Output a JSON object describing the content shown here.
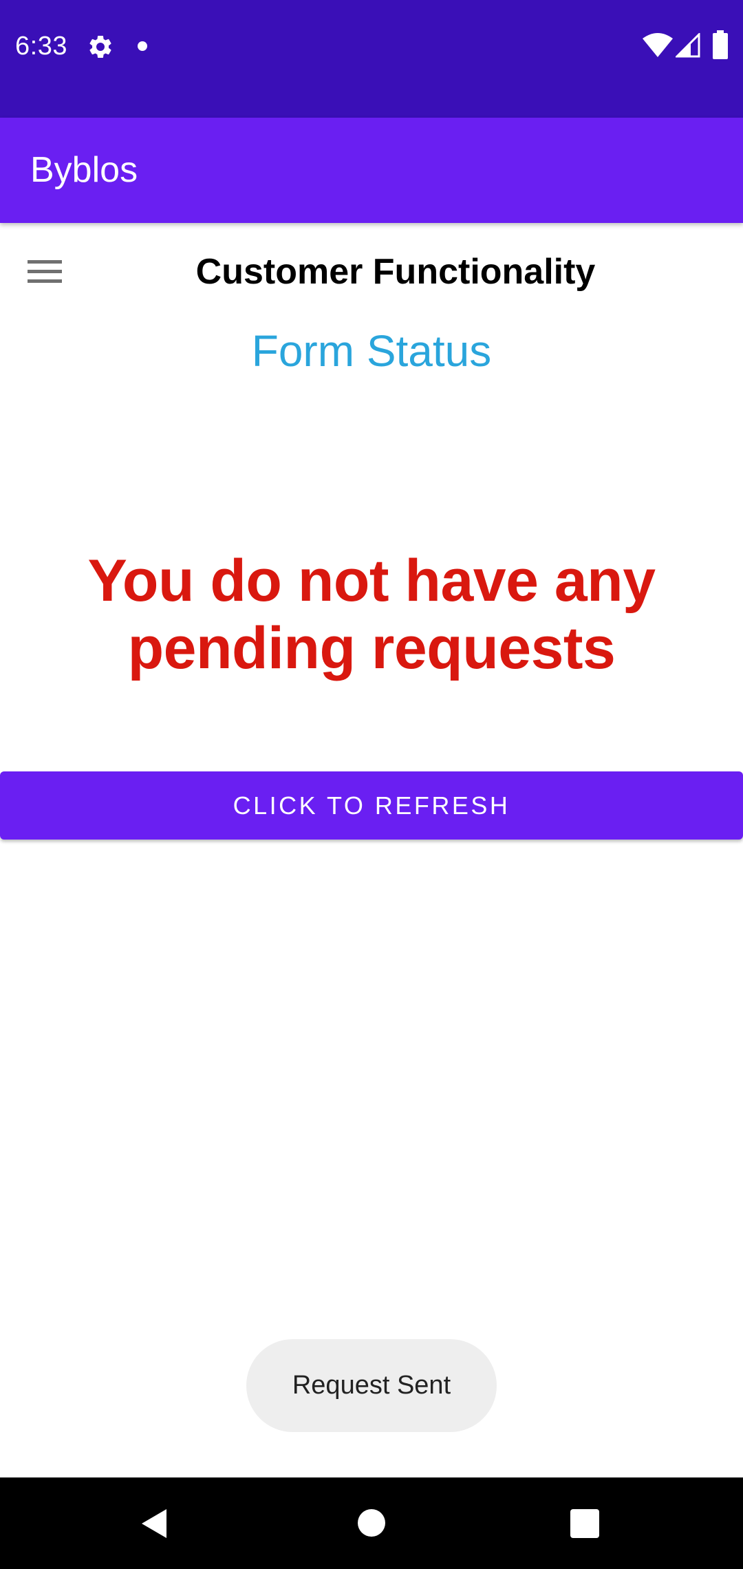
{
  "status_bar": {
    "time": "6:33",
    "icons": [
      "gear-icon",
      "notification-dot-icon",
      "wifi-icon",
      "signal-icon",
      "battery-icon"
    ],
    "background_color": "#3a0fb7"
  },
  "app_bar": {
    "title": "Byblos",
    "background_color": "#6a1ff2"
  },
  "header": {
    "menu_icon": "hamburger-menu-icon",
    "title": "Customer Functionality"
  },
  "main": {
    "subtitle": "Form Status",
    "subtitle_color": "#2aa5dc",
    "message": "You do not have any pending requests",
    "message_color": "#d9180f",
    "refresh_button_label": "CLICK TO REFRESH",
    "button_color": "#6a1ff2"
  },
  "toast": {
    "text": "Request Sent"
  },
  "nav_bar": {
    "icons": [
      "back-icon",
      "home-icon",
      "recents-icon"
    ]
  }
}
